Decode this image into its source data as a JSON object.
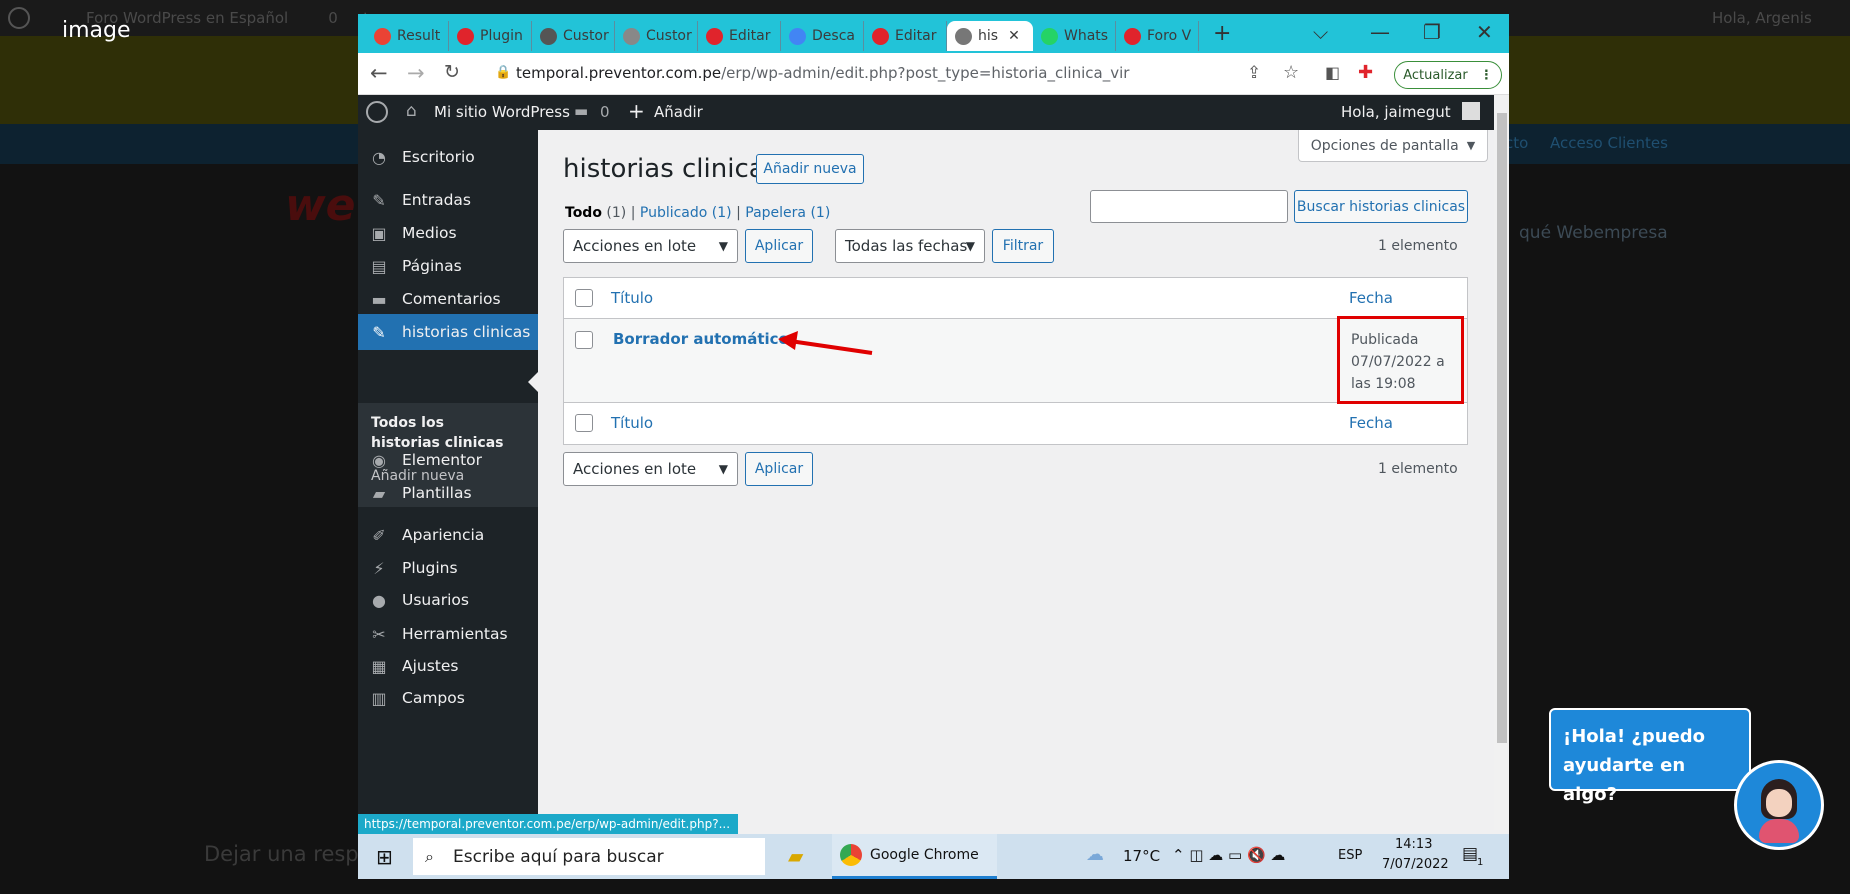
{
  "caption": "image",
  "background": {
    "topbar_items": [
      "Foro WordPress en Español",
      "0",
      "+",
      "Hola, Argenis"
    ],
    "nav_right": [
      "cto",
      "Acceso Clientes"
    ],
    "text_right": "qué Webempresa",
    "logo": "we",
    "bottom_text": "Dejar una resp"
  },
  "browser": {
    "tabs": [
      {
        "label": "Result",
        "icon": "gmail-icon",
        "color": "#ea4335"
      },
      {
        "label": "Plugin",
        "icon": "webempresa-icon",
        "color": "#e0242c"
      },
      {
        "label": "Custor",
        "icon": "wordpress-icon",
        "color": "#555"
      },
      {
        "label": "Custor",
        "icon": "globe-icon",
        "color": "#888"
      },
      {
        "label": "Editar",
        "icon": "pdf-icon",
        "color": "#e0242c"
      },
      {
        "label": "Desca",
        "icon": "google-icon",
        "color": "#4285f4"
      },
      {
        "label": "Editar",
        "icon": "pdf-icon",
        "color": "#e0242c"
      }
    ],
    "active_tab": {
      "label": "his",
      "icon": "globe-icon"
    },
    "tabs_after": [
      {
        "label": "Whats",
        "icon": "whatsapp-icon",
        "color": "#25d366"
      },
      {
        "label": "Foro V",
        "icon": "webempresa-icon",
        "color": "#e0242c"
      }
    ],
    "new_tab": "+",
    "url_host": "temporal.preventor.com.pe",
    "url_path": "/erp/wp-admin/edit.php?post_type=historia_clinica_vir",
    "update_label": "Actualizar",
    "status_url": "https://temporal.preventor.com.pe/erp/wp-admin/edit.php?..."
  },
  "adminbar": {
    "site": "Mi sitio WordPress",
    "comments": "0",
    "new": "Añadir",
    "greeting": "Hola, jaimegut"
  },
  "sidebar": {
    "items": [
      {
        "label": "Escritorio",
        "icon": "dashboard-icon",
        "glyph": "◔"
      },
      {
        "label": "Entradas",
        "icon": "pin-icon",
        "glyph": "✎"
      },
      {
        "label": "Medios",
        "icon": "media-icon",
        "glyph": "▣"
      },
      {
        "label": "Páginas",
        "icon": "pages-icon",
        "glyph": "▤"
      },
      {
        "label": "Comentarios",
        "icon": "comment-icon",
        "glyph": "▬"
      },
      {
        "label": "historias clinicas",
        "icon": "pin-icon",
        "glyph": "✎"
      },
      {
        "label": "Elementor",
        "icon": "elementor-icon",
        "glyph": "◉"
      },
      {
        "label": "Plantillas",
        "icon": "folder-icon",
        "glyph": "▰"
      },
      {
        "label": "Apariencia",
        "icon": "brush-icon",
        "glyph": "✐"
      },
      {
        "label": "Plugins",
        "icon": "plugin-icon",
        "glyph": "⚡"
      },
      {
        "label": "Usuarios",
        "icon": "user-icon",
        "glyph": "●"
      },
      {
        "label": "Herramientas",
        "icon": "wrench-icon",
        "glyph": "✂"
      },
      {
        "label": "Ajustes",
        "icon": "settings-icon",
        "glyph": "▦"
      },
      {
        "label": "Campos",
        "icon": "fields-icon",
        "glyph": "▥"
      }
    ],
    "submenu": {
      "all": "Todos los historias clinicas",
      "add": "Añadir nueva"
    }
  },
  "main": {
    "screen_options": "Opciones de pantalla",
    "title": "historias clinicas",
    "add_new": "Añadir nueva",
    "search_button": "Buscar historias clinicas",
    "filters": {
      "all": "Todo",
      "all_count": "(1)",
      "published": "Publicado",
      "published_count": "(1)",
      "trash": "Papelera",
      "trash_count": "(1)"
    },
    "bulk_actions": "Acciones en lote",
    "apply": "Aplicar",
    "dates": "Todas las fechas",
    "filter": "Filtrar",
    "count": "1 elemento",
    "columns": {
      "title": "Título",
      "date": "Fecha"
    },
    "rows": [
      {
        "title": "Borrador automático",
        "status": "Publicada",
        "date": "07/07/2022 a",
        "time": "las 19:08"
      }
    ]
  },
  "taskbar": {
    "search_placeholder": "Escribe aquí para buscar",
    "app": "Google Chrome",
    "temp": "17°C",
    "lang": "ESP",
    "time": "14:13",
    "date": "7/07/2022",
    "notif": "1"
  },
  "chat": {
    "line1": "¡Hola! ¿puedo",
    "line2": "ayudarte en algo?"
  },
  "colors": {
    "accent": "#2271b1",
    "tabbar": "#22c3d8",
    "annotation": "#e00000",
    "admin": "#1d2327"
  }
}
